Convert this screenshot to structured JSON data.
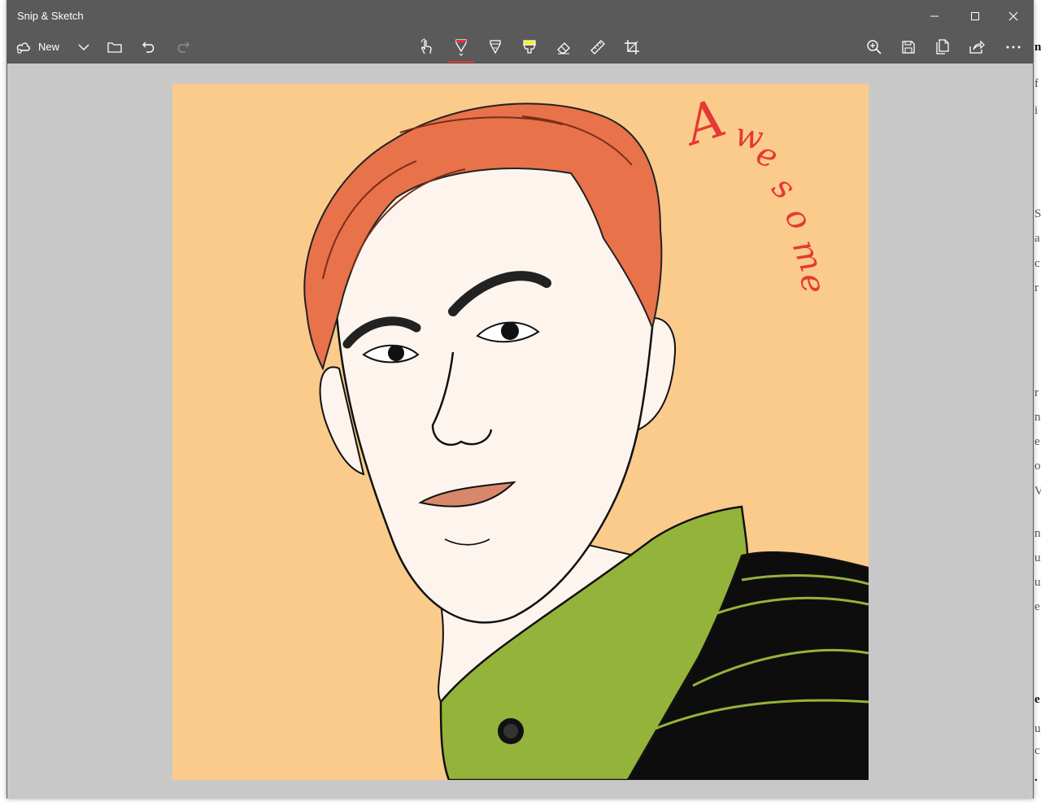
{
  "window": {
    "title": "Snip & Sketch"
  },
  "toolbar": {
    "new_label": "New",
    "left_icons": [
      "new-snip-icon",
      "chevron-down-icon",
      "folder-icon",
      "undo-icon",
      "redo-icon"
    ],
    "center_icons": [
      "touch-writing-icon",
      "ballpoint-pen-icon",
      "pencil-icon",
      "highlighter-icon",
      "eraser-icon",
      "ruler-icon",
      "crop-icon"
    ],
    "right_icons": [
      "zoom-icon",
      "save-icon",
      "copy-icon",
      "share-icon",
      "more-icon"
    ],
    "selected_tool": "ballpoint-pen",
    "pen_color": "#e53935",
    "highlighter_color": "#ffee00"
  },
  "canvas": {
    "annotation_text": "Awesome",
    "annotation_color": "#e53935",
    "background_color": "#fbcb8c"
  },
  "colors": {
    "titlebar": "#5a5a5a",
    "canvas_area": "#c8c8c8"
  }
}
